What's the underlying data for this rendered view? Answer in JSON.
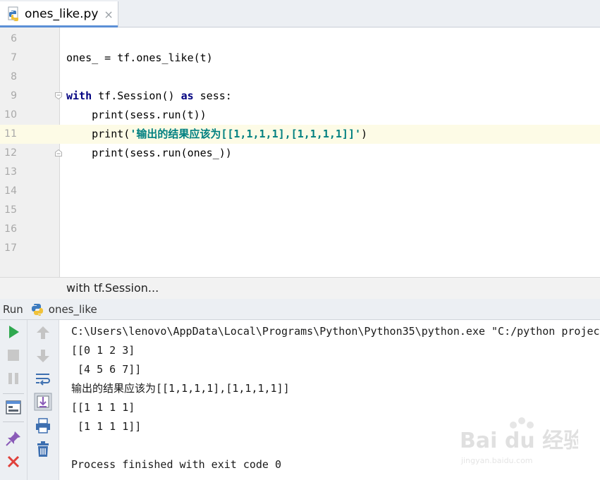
{
  "tab": {
    "filename": "ones_like.py",
    "close_glyph": "×",
    "icon": "python-file-icon"
  },
  "editor": {
    "lines": [
      {
        "n": "6"
      },
      {
        "n": "7"
      },
      {
        "n": "8"
      },
      {
        "n": "9"
      },
      {
        "n": "10"
      },
      {
        "n": "11"
      },
      {
        "n": "12"
      },
      {
        "n": "13"
      },
      {
        "n": "14"
      },
      {
        "n": "15"
      },
      {
        "n": "16"
      },
      {
        "n": "17"
      }
    ],
    "code": {
      "l7": "ones_ = tf.ones_like(t)",
      "l9_kw1": "with",
      "l9_mid": " tf.Session() ",
      "l9_kw2": "as",
      "l9_end": " sess:",
      "l10": "    print(sess.run(t))",
      "l11_pre": "    print(",
      "l11_str": "'输出的结果应该为[[1,1,1,1],[1,1,1,1]]'",
      "l11_post": ")",
      "l12": "    print(sess.run(ones_))"
    },
    "breadcrumb": "with tf.Session..."
  },
  "run": {
    "title": "Run",
    "config": "ones_like",
    "output": [
      "C:\\Users\\lenovo\\AppData\\Local\\Programs\\Python\\Python35\\python.exe \"C:/python project",
      "[[0 1 2 3]",
      " [4 5 6 7]]",
      "输出的结果应该为[[1,1,1,1],[1,1,1,1]]",
      "[[1 1 1 1]",
      " [1 1 1 1]]",
      "",
      "Process finished with exit code 0"
    ]
  },
  "watermark": {
    "brand": "Bai du 经验",
    "url": "jingyan.baidu.com"
  },
  "colors": {
    "keyword": "#000080",
    "string": "#008080",
    "current_line": "#fdfbe6",
    "run_green": "#2fa84f",
    "stop_red": "#e0403a"
  }
}
